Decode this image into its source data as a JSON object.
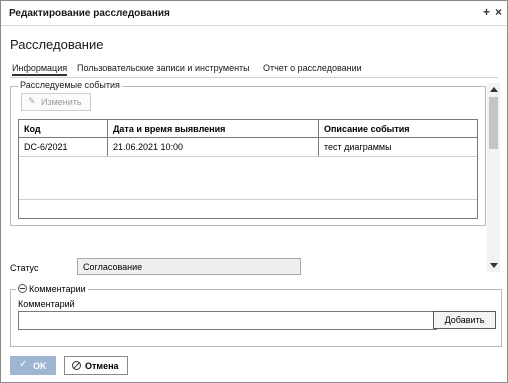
{
  "window": {
    "title": "Редактирование расследования",
    "pin_glyph": "+",
    "close_glyph": "×"
  },
  "page_title": "Расследование",
  "tabs": [
    {
      "label": "Информация",
      "active": true
    },
    {
      "label": "Пользовательские записи и инструменты",
      "active": false
    },
    {
      "label": "Отчет о расследовании",
      "active": false
    }
  ],
  "events_section": {
    "legend": "Расследуемые события",
    "edit_button": "Изменить",
    "edit_icon": "pencil-icon",
    "columns": [
      "Код",
      "Дата и время выявления",
      "Описание события"
    ],
    "rows": [
      [
        "DC-6/2021",
        "21.06.2021 10:00",
        "тест диаграммы"
      ]
    ]
  },
  "status": {
    "label": "Статус",
    "value": "Согласование"
  },
  "comments_section": {
    "legend": "Комментарии",
    "field_label": "Комментарий",
    "input_value": "",
    "add_button": "Добавить"
  },
  "footer": {
    "ok_label": "OK",
    "cancel_label": "Отмена"
  },
  "colors": {
    "ok_button_bg": "#9fb6d3",
    "status_field_bg": "#efefef"
  }
}
